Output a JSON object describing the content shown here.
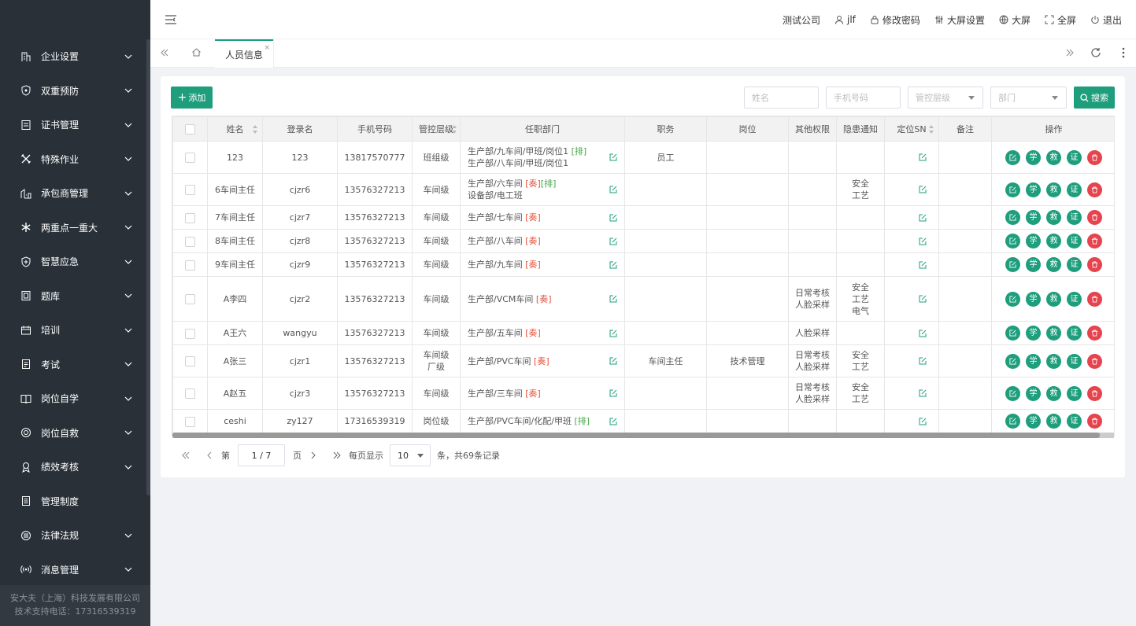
{
  "sidebar": {
    "items": [
      {
        "label": "企业设置",
        "icon": "building-icon",
        "expandable": true
      },
      {
        "label": "双重预防",
        "icon": "shield-icon",
        "expandable": true
      },
      {
        "label": "证书管理",
        "icon": "certificate-icon",
        "expandable": true
      },
      {
        "label": "特殊作业",
        "icon": "tools-icon",
        "expandable": true
      },
      {
        "label": "承包商管理",
        "icon": "contractor-icon",
        "expandable": true
      },
      {
        "label": "两重点一重大",
        "icon": "asterisk-icon",
        "expandable": true
      },
      {
        "label": "智慧应急",
        "icon": "emergency-icon",
        "expandable": true
      },
      {
        "label": "题库",
        "icon": "question-bank-icon",
        "expandable": true
      },
      {
        "label": "培训",
        "icon": "training-icon",
        "expandable": true
      },
      {
        "label": "考试",
        "icon": "exam-icon",
        "expandable": true
      },
      {
        "label": "岗位自学",
        "icon": "book-icon",
        "expandable": true
      },
      {
        "label": "岗位自救",
        "icon": "lifebuoy-icon",
        "expandable": true
      },
      {
        "label": "绩效考核",
        "icon": "medal-icon",
        "expandable": true
      },
      {
        "label": "管理制度",
        "icon": "document-icon",
        "expandable": false
      },
      {
        "label": "法律法规",
        "icon": "law-icon",
        "expandable": true
      },
      {
        "label": "消息管理",
        "icon": "broadcast-icon",
        "expandable": true
      }
    ],
    "footer_company": "安大夫（上海）科技发展有限公司",
    "footer_phone": "技术支持电话：17316539319"
  },
  "header": {
    "company": "测试公司",
    "user": "jlf",
    "change_password": "修改密码",
    "screen_settings": "大屏设置",
    "big_screen": "大屏",
    "fullscreen": "全屏",
    "logout": "退出"
  },
  "tabs": {
    "active": "人员信息",
    "close": "×"
  },
  "toolbar": {
    "add_label": "添加",
    "name_placeholder": "姓名",
    "phone_placeholder": "手机号码",
    "level_placeholder": "管控层级",
    "dept_placeholder": "部门",
    "search_label": "搜索"
  },
  "table": {
    "columns": [
      "姓名",
      "登录名",
      "手机号码",
      "管控层级",
      "任职部门",
      "职务",
      "岗位",
      "其他权限",
      "隐患通知",
      "定位SN",
      "备注",
      "操作"
    ],
    "ops": [
      "学",
      "救",
      "证"
    ],
    "rows": [
      {
        "name": "123",
        "login": "123",
        "phone": "13817570777",
        "level": [
          "班组级"
        ],
        "dept": [
          {
            "text": "生产部/九车间/甲班/岗位1 ",
            "tags": [
              {
                "t": "[排]",
                "c": "p"
              }
            ]
          },
          {
            "text": "生产部/八车间/甲班/岗位1",
            "tags": []
          }
        ],
        "duty": "员工",
        "post": "",
        "perm": [],
        "notice": []
      },
      {
        "name": "6车间主任",
        "login": "cjzr6",
        "phone": "13576327213",
        "level": [
          "车间级"
        ],
        "dept": [
          {
            "text": "生产部/六车间 ",
            "tags": [
              {
                "t": "[奏]",
                "c": "q"
              },
              {
                "t": "[排]",
                "c": "p"
              }
            ]
          },
          {
            "text": "设备部/电工班",
            "tags": []
          }
        ],
        "duty": "",
        "post": "",
        "perm": [],
        "notice": [
          "安全",
          "工艺"
        ]
      },
      {
        "name": "7车间主任",
        "login": "cjzr7",
        "phone": "13576327213",
        "level": [
          "车间级"
        ],
        "dept": [
          {
            "text": "生产部/七车间 ",
            "tags": [
              {
                "t": "[奏]",
                "c": "q"
              }
            ]
          }
        ],
        "duty": "",
        "post": "",
        "perm": [],
        "notice": []
      },
      {
        "name": "8车间主任",
        "login": "cjzr8",
        "phone": "13576327213",
        "level": [
          "车间级"
        ],
        "dept": [
          {
            "text": "生产部/八车间 ",
            "tags": [
              {
                "t": "[奏]",
                "c": "q"
              }
            ]
          }
        ],
        "duty": "",
        "post": "",
        "perm": [],
        "notice": []
      },
      {
        "name": "9车间主任",
        "login": "cjzr9",
        "phone": "13576327213",
        "level": [
          "车间级"
        ],
        "dept": [
          {
            "text": "生产部/九车间 ",
            "tags": [
              {
                "t": "[奏]",
                "c": "q"
              }
            ]
          }
        ],
        "duty": "",
        "post": "",
        "perm": [],
        "notice": []
      },
      {
        "name": "A李四",
        "login": "cjzr2",
        "phone": "13576327213",
        "level": [
          "车间级"
        ],
        "dept": [
          {
            "text": "生产部/VCM车间 ",
            "tags": [
              {
                "t": "[奏]",
                "c": "q"
              }
            ]
          }
        ],
        "duty": "",
        "post": "",
        "perm": [
          "日常考核",
          "人脸采样"
        ],
        "notice": [
          "安全",
          "工艺",
          "电气"
        ]
      },
      {
        "name": "A王六",
        "login": "wangyu",
        "phone": "13576327213",
        "level": [
          "车间级"
        ],
        "dept": [
          {
            "text": "生产部/五车间 ",
            "tags": [
              {
                "t": "[奏]",
                "c": "q"
              }
            ]
          }
        ],
        "duty": "",
        "post": "",
        "perm": [
          "人脸采样"
        ],
        "notice": []
      },
      {
        "name": "A张三",
        "login": "cjzr1",
        "phone": "13576327213",
        "level": [
          "车间级",
          "厂级"
        ],
        "dept": [
          {
            "text": "生产部/PVC车间 ",
            "tags": [
              {
                "t": "[奏]",
                "c": "q"
              }
            ]
          }
        ],
        "duty": "车间主任",
        "post": "技术管理",
        "perm": [
          "日常考核",
          "人脸采样"
        ],
        "notice": [
          "安全",
          "工艺"
        ]
      },
      {
        "name": "A赵五",
        "login": "cjzr3",
        "phone": "13576327213",
        "level": [
          "车间级"
        ],
        "dept": [
          {
            "text": "生产部/三车间 ",
            "tags": [
              {
                "t": "[奏]",
                "c": "q"
              }
            ]
          }
        ],
        "duty": "",
        "post": "",
        "perm": [
          "日常考核",
          "人脸采样"
        ],
        "notice": [
          "安全",
          "工艺"
        ]
      },
      {
        "name": "ceshi",
        "login": "zy127",
        "phone": "17316539319",
        "level": [
          "岗位级"
        ],
        "dept": [
          {
            "text": "生产部/PVC车间/化配/甲班 ",
            "tags": [
              {
                "t": "[排]",
                "c": "p"
              }
            ]
          }
        ],
        "duty": "",
        "post": "",
        "perm": [],
        "notice": []
      }
    ]
  },
  "pager": {
    "page_prefix": "第",
    "page_value": "1 / 7",
    "page_suffix": "页",
    "per_page_label": "每页显示",
    "page_size": "10",
    "total": "条，共69条记录"
  },
  "colors": {
    "primary": "#1e9e7c",
    "danger": "#e5434d",
    "sidebar": "#293038"
  }
}
